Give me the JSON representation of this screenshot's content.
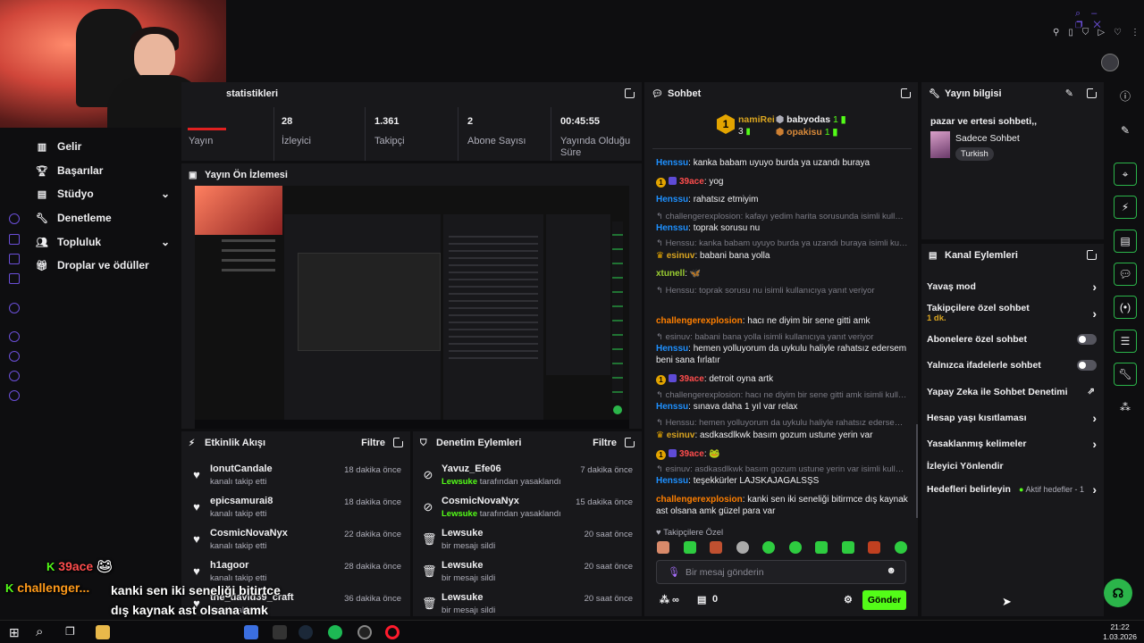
{
  "topbar": {
    "icons": [
      "search-icon",
      "minimize-icon",
      "restore-icon",
      "close-icon"
    ],
    "icons2": [
      "pin-icon",
      "bookmark-icon",
      "shield-icon",
      "play-icon",
      "heart-icon",
      "more-icon"
    ]
  },
  "sidebar": {
    "items": [
      {
        "label": "Gelir",
        "icon": "chart-icon"
      },
      {
        "label": "Başarılar",
        "icon": "trophy-icon"
      },
      {
        "label": "Stüdyo",
        "icon": "studio-icon",
        "chevron": true
      },
      {
        "label": "Denetleme",
        "icon": "wrench-icon"
      },
      {
        "label": "Topluluk",
        "icon": "people-icon",
        "chevron": true
      },
      {
        "label": "Droplar ve ödüller",
        "icon": "gift-icon"
      }
    ]
  },
  "stats": {
    "title": "statistikleri",
    "items": [
      {
        "value": "",
        "label": "Yayın"
      },
      {
        "value": "28",
        "label": "İzleyici"
      },
      {
        "value": "1.361",
        "label": "Takipçi"
      },
      {
        "value": "2",
        "label": "Abone Sayısı"
      },
      {
        "value": "00:45:55",
        "label": "Yayında Olduğu Süre"
      }
    ]
  },
  "preview": {
    "title": "Yayın Ön İzlemesi"
  },
  "activity": {
    "title": "Etkinlik Akışı",
    "filter": "Filtre",
    "rows": [
      {
        "name": "IonutCandale",
        "sub": "kanalı takip etti",
        "time": "18 dakika önce"
      },
      {
        "name": "epicsamurai8",
        "sub": "kanalı takip etti",
        "time": "18 dakika önce"
      },
      {
        "name": "CosmicNovaNyx",
        "sub": "kanalı takip etti",
        "time": "22 dakika önce"
      },
      {
        "name": "h1agoor",
        "sub": "kanalı takip etti",
        "time": "28 dakika önce"
      },
      {
        "name": "the_david39_craft",
        "sub": "kanalı takip etti",
        "time": "36 dakika önce"
      }
    ]
  },
  "moderation": {
    "title": "Denetim Eylemleri",
    "filter": "Filtre",
    "rows": [
      {
        "name": "Yavuz_Efe06",
        "by": "Lewsuke",
        "sub": "tarafından yasaklandı",
        "time": "7 dakika önce",
        "icon": "ban-icon"
      },
      {
        "name": "CosmicNovaNyx",
        "by": "Lewsuke",
        "sub": "tarafından yasaklandı",
        "time": "15 dakika önce",
        "icon": "ban-icon"
      },
      {
        "name": "Lewsuke",
        "by": "",
        "sub": "bir mesajı sildi",
        "time": "20 saat önce",
        "icon": "trash-icon"
      },
      {
        "name": "Lewsuke",
        "by": "",
        "sub": "bir mesajı sildi",
        "time": "20 saat önce",
        "icon": "trash-icon"
      },
      {
        "name": "Lewsuke",
        "by": "",
        "sub": "bir mesajı sildi",
        "time": "20 saat önce",
        "icon": "trash-icon"
      }
    ]
  },
  "chat": {
    "title": "Sohbet",
    "leaders": {
      "first": {
        "rank": "1",
        "name": "namiRei",
        "count": "3"
      },
      "second": {
        "name": "babyodas",
        "count": "1"
      },
      "third": {
        "name": "opakisu",
        "count": "1"
      }
    },
    "messages": [
      {
        "type": "msg",
        "user": "Henssu",
        "cls": "un-blue",
        "text": "kanka babam uyuyo burda ya uzandı buraya"
      },
      {
        "type": "msg",
        "user": "39ace",
        "cls": "un-red",
        "badge": true,
        "text": "yog"
      },
      {
        "type": "msg",
        "user": "Henssu",
        "cls": "un-blue",
        "text": "rahatsız etmiyim"
      },
      {
        "type": "reply",
        "text": "challengerexplosion: kafayı yedim harita sorusunda isimli kullanıcı..."
      },
      {
        "type": "msg",
        "user": "Henssu",
        "cls": "un-blue",
        "text": "toprak sorusu nu"
      },
      {
        "type": "reply",
        "text": "Henssu: kanka babam uyuyo burda ya uzandı buraya isimli kullanıcı..."
      },
      {
        "type": "msg",
        "user": "esinuv",
        "cls": "un-gold",
        "crown": true,
        "text": "babani bana yolla"
      },
      {
        "type": "msg",
        "user": "xtunell",
        "cls": "un-green",
        "text": "🦋"
      },
      {
        "type": "reply",
        "text": "Henssu: toprak sorusu nu isimli kullanıcıya yanıt veriyor"
      },
      {
        "type": "msg",
        "user": "challengerexplosion",
        "cls": "un-orange",
        "text": "hacı ne diyim bir sene gitti amk"
      },
      {
        "type": "reply",
        "text": "esinuv: babani bana yolla isimli kullanıcıya yanıt veriyor"
      },
      {
        "type": "msg",
        "user": "Henssu",
        "cls": "un-blue",
        "text": "hemen yolluyorum da uykulu haliyle rahatsız edersem beni sana fırlatır"
      },
      {
        "type": "msg",
        "user": "39ace",
        "cls": "un-red",
        "badge": true,
        "text": "detroit oyna artk"
      },
      {
        "type": "reply",
        "text": "challengerexplosion: hacı ne diyim bir sene gitti amk isimli kullanıcı..."
      },
      {
        "type": "msg",
        "user": "Henssu",
        "cls": "un-blue",
        "text": "sınava daha 1 yıl var relax"
      },
      {
        "type": "reply",
        "text": "Henssu: hemen yolluyorum da uykulu haliyle rahatsız edersem beni..."
      },
      {
        "type": "msg",
        "user": "esinuv",
        "cls": "un-gold",
        "crown": true,
        "text": "asdkasdlkwk basım gozum ustune yerin var"
      },
      {
        "type": "msg",
        "user": "39ace",
        "cls": "un-red",
        "badge": true,
        "text": "🐸"
      },
      {
        "type": "reply",
        "text": "esinuv: asdkasdlkwk basım gozum ustune yerin var isimli kullanıcı..."
      },
      {
        "type": "msg",
        "user": "Henssu",
        "cls": "un-blue",
        "text": "teşekkürler LAJSKAJAGALSŞS"
      },
      {
        "type": "msg",
        "user": "challengerexplosion",
        "cls": "un-orange",
        "text": "kanki sen iki seneliği bitirmce dış kaynak ast olsana amk güzel para var"
      }
    ],
    "follower_only": "Takipçilere Özel",
    "input_placeholder": "Bir mesaj gönderin",
    "points": "0",
    "send": "Gönder"
  },
  "stream_info": {
    "title": "Yayın bilgisi",
    "stream_title": "pazar ve ertesi sohbeti,,",
    "category": "Sadece Sohbet",
    "tag": "Turkish"
  },
  "channel_actions": {
    "title": "Kanal Eylemleri",
    "slow": "Yavaş mod",
    "followers_chat": "Takipçilere özel sohbet",
    "followers_sub": "1 dk.",
    "subs_chat": "Abonelere özel sohbet",
    "emote_chat": "Yalnızca ifadelerle sohbet",
    "ai_mod": "Yapay Zeka ile Sohbet Denetimi",
    "age": "Hesap yaşı kısıtlaması",
    "banned_words": "Yasaklanmış kelimeler",
    "raid": "İzleyici Yönlendir",
    "goals": "Hedefleri belirleyin",
    "goals_status": "Aktif hedefler - 1"
  },
  "overlay": {
    "line1_user": "39ace",
    "line2_user": "challenger...",
    "line2_text": "kanki sen iki seneliği bitirtce dış kaynak ast olsana amk güzel para var"
  },
  "taskbar": {
    "time": "21:22",
    "date": "1.03.2026"
  },
  "colors": {
    "accent": "#53fc18",
    "panel": "#18181b",
    "bg": "#0e0e10"
  }
}
